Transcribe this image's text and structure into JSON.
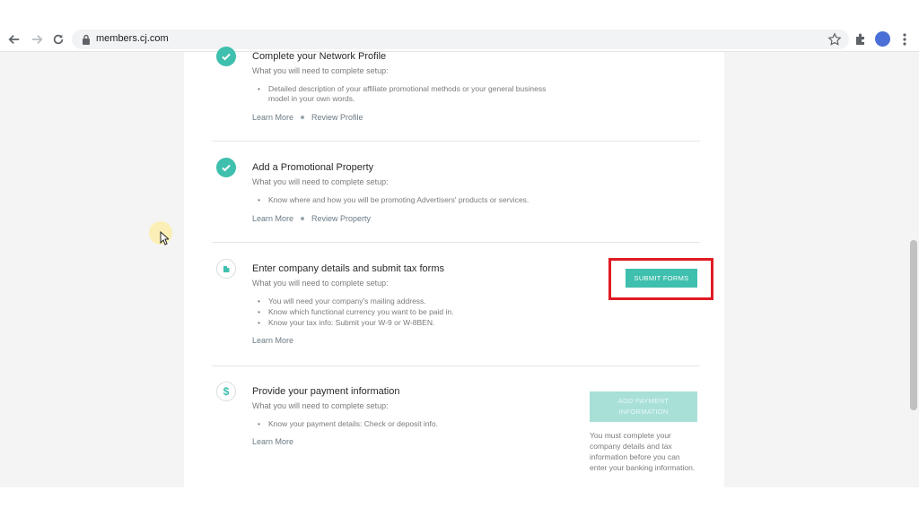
{
  "browser": {
    "url": "members.cj.com",
    "back_icon": "arrow-left-icon",
    "forward_icon": "arrow-right-icon",
    "reload_icon": "reload-icon",
    "lock_icon": "lock-icon",
    "star_icon": "star-icon",
    "extensions_icon": "puzzle-icon",
    "menu_icon": "kebab-menu-icon"
  },
  "steps": [
    {
      "title": "Complete your Network Profile",
      "subtitle": "What you will need to complete setup:",
      "bullets": [
        "Detailed description of your affiliate promotional methods or your general business model in your own words."
      ],
      "links": [
        "Learn More",
        "Review Profile"
      ],
      "status": "complete"
    },
    {
      "title": "Add a Promotional Property",
      "subtitle": "What you will need to complete setup:",
      "bullets": [
        "Know where and how you will be promoting Advertisers' products or services."
      ],
      "links": [
        "Learn More",
        "Review Property"
      ],
      "status": "complete"
    },
    {
      "title": "Enter company details and submit tax forms",
      "subtitle": "What you will need to complete setup:",
      "bullets": [
        "You will need your company's mailing address.",
        "Know which functional currency you want to be paid in.",
        "Know your tax info: Submit your W-9 or W-8BEN."
      ],
      "links": [
        "Learn More"
      ],
      "button": "SUBMIT FORMS",
      "status": "todo",
      "icon": "building-icon"
    },
    {
      "title": "Provide your payment information",
      "subtitle": "What you will need to complete setup:",
      "bullets": [
        "Know your payment details: Check or deposit info."
      ],
      "links": [
        "Learn More"
      ],
      "button": "ADD PAYMENT INFORMATION",
      "note": "You must complete your company details and tax information before you can enter your banking information.",
      "status": "locked",
      "icon": "dollar-icon",
      "icon_glyph": "$"
    }
  ],
  "colors": {
    "accent": "#3fbfae",
    "accent_disabled": "#a8e0d8",
    "highlight": "#e01b24"
  }
}
